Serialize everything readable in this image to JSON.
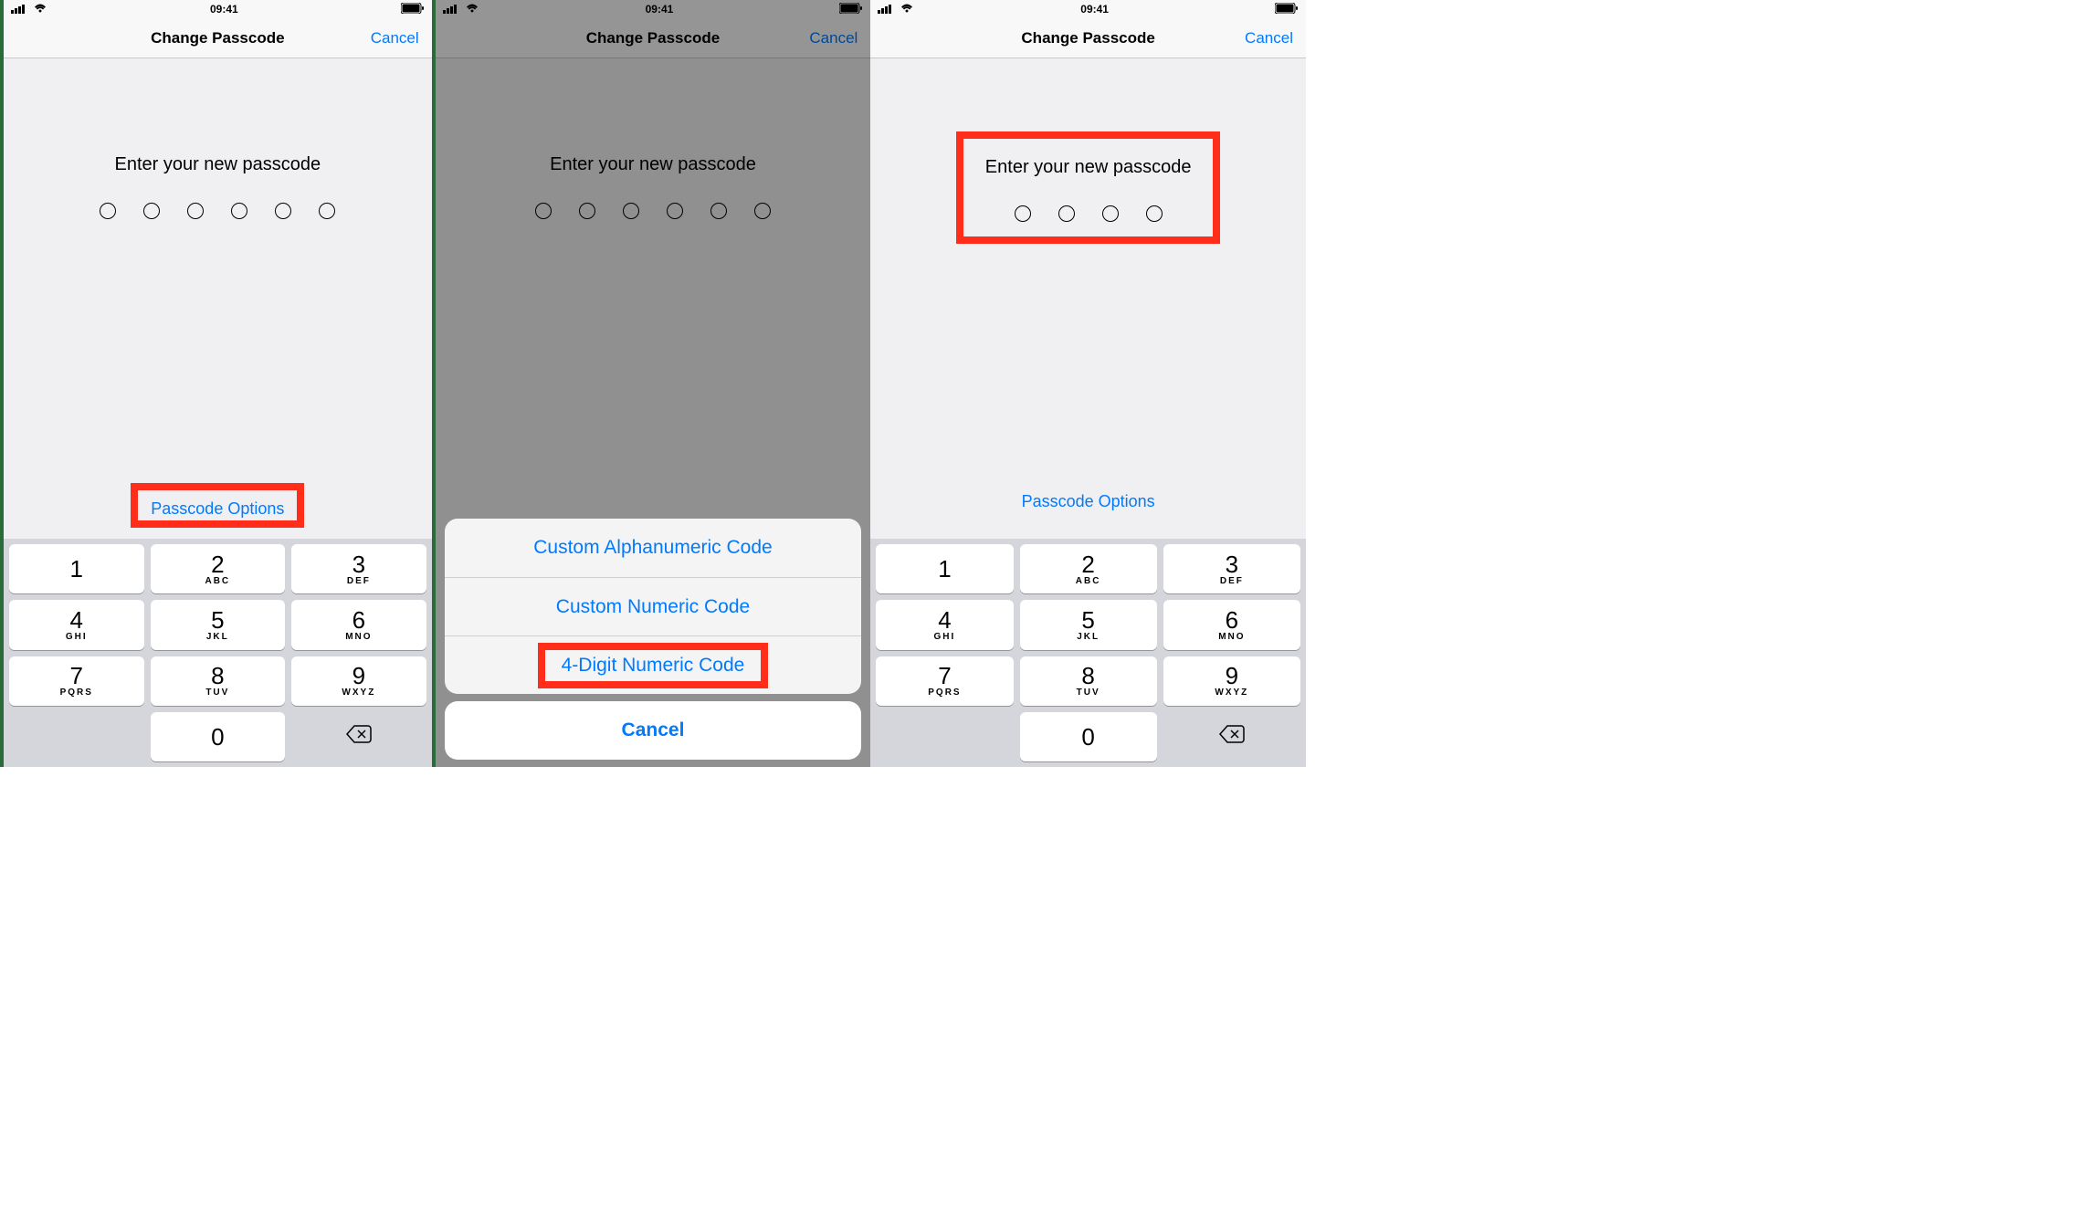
{
  "status": {
    "time": "09:41"
  },
  "nav": {
    "title": "Change Passcode",
    "cancel": "Cancel"
  },
  "prompt": "Enter your new passcode",
  "options_link": "Passcode Options",
  "keypad": {
    "k1": {
      "num": "1",
      "sub": " "
    },
    "k2": {
      "num": "2",
      "sub": "ABC"
    },
    "k3": {
      "num": "3",
      "sub": "DEF"
    },
    "k4": {
      "num": "4",
      "sub": "GHI"
    },
    "k5": {
      "num": "5",
      "sub": "JKL"
    },
    "k6": {
      "num": "6",
      "sub": "MNO"
    },
    "k7": {
      "num": "7",
      "sub": "PQRS"
    },
    "k8": {
      "num": "8",
      "sub": "TUV"
    },
    "k9": {
      "num": "9",
      "sub": "WXYZ"
    },
    "k0": {
      "num": "0",
      "sub": ""
    }
  },
  "sheet": {
    "alpha": "Custom Alphanumeric Code",
    "numeric": "Custom Numeric Code",
    "four": "4-Digit Numeric Code",
    "cancel": "Cancel"
  },
  "highlight": {
    "screen1": "passcode-options",
    "screen2": "4-digit-numeric-code",
    "screen3": "prompt-and-dots"
  },
  "dots": {
    "screen1": 6,
    "screen2": 6,
    "screen3": 4
  }
}
